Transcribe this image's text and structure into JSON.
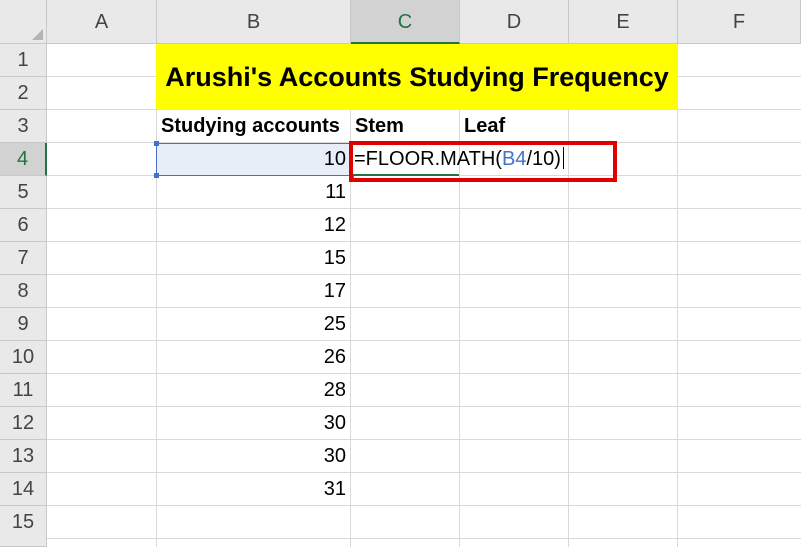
{
  "columns": [
    "A",
    "B",
    "C",
    "D",
    "E",
    "F"
  ],
  "rows": [
    "1",
    "2",
    "3",
    "4",
    "5",
    "6",
    "7",
    "8",
    "9",
    "10",
    "11",
    "12",
    "13",
    "14",
    "15"
  ],
  "active_column": "C",
  "active_row": "4",
  "title": "Arushi's Accounts Studying Frequency",
  "title_fill_color": "#ffff00",
  "headers": {
    "studying_accounts": "Studying accounts",
    "stem": "Stem",
    "leaf": "Leaf"
  },
  "values": [
    "10",
    "11",
    "12",
    "15",
    "17",
    "25",
    "26",
    "28",
    "30",
    "30",
    "31"
  ],
  "formula": {
    "prefix": "=FLOOR.MATH(",
    "ref": "B4",
    "suffix": "/10)"
  },
  "colors": {
    "reference": "#4472c4",
    "highlight_box": "#e00000",
    "active_header": "#217346"
  }
}
